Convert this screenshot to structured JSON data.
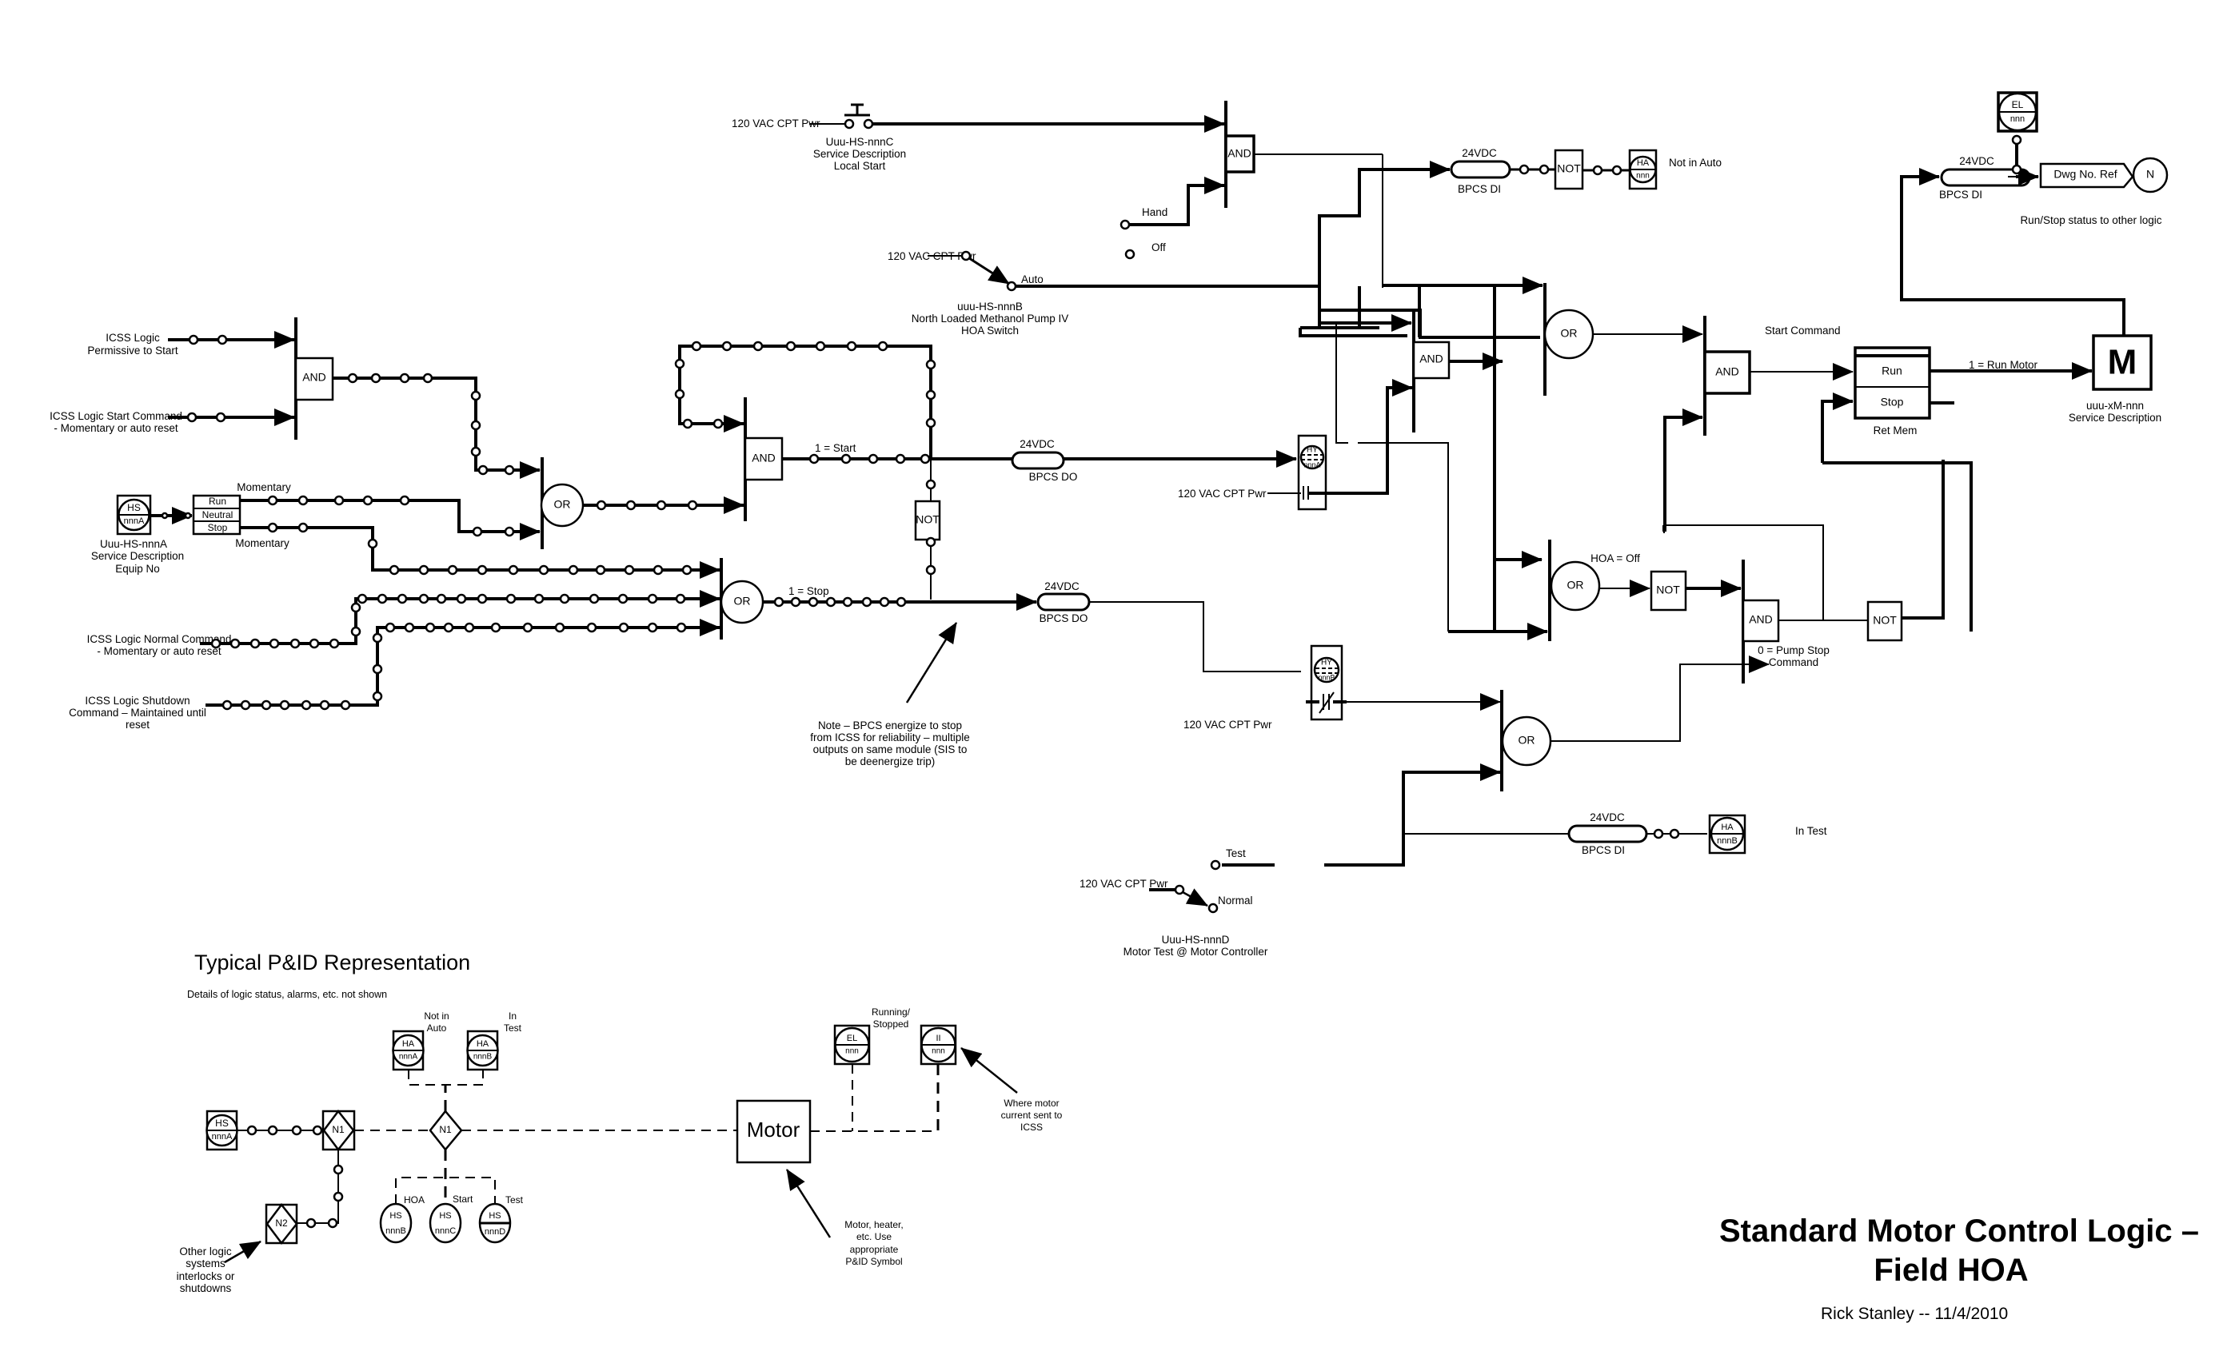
{
  "title": {
    "line1": "Standard Motor Control Logic –",
    "line2": "Field HOA",
    "author_date": "Rick Stanley --  11/4/2010"
  },
  "power_label": "120 VAC CPT Pwr",
  "io": {
    "v24": "24VDC",
    "bpcs_di": "BPCS DI",
    "bpcs_do": "BPCS DO"
  },
  "gates": {
    "and": "AND",
    "or": "OR",
    "not": "NOT"
  },
  "local_start": {
    "tag": "Uuu-HS-nnnC",
    "desc": "Service Description",
    "function": "Local Start"
  },
  "hoa_switch": {
    "tag": "uuu-HS-nnnB",
    "desc": "North Loaded Methanol Pump IV",
    "function": "HOA Switch",
    "positions": [
      "Hand",
      "Off",
      "Auto"
    ]
  },
  "test_switch": {
    "tag": "Uuu-HS-nnnD",
    "desc": "Motor Test @ Motor Controller",
    "positions": [
      "Test",
      "Normal"
    ]
  },
  "icss_inputs": {
    "permissive": [
      "ICSS Logic",
      "Permissive to Start"
    ],
    "start_cmd": [
      "ICSS Logic Start Command",
      "- Momentary or auto reset"
    ],
    "normal_cmd": [
      "ICSS Logic Normal Command",
      "- Momentary or auto reset"
    ],
    "shutdown_cmd": [
      "ICSS Logic Shutdown",
      "Command – Maintained until",
      "reset"
    ]
  },
  "hs_a": {
    "letters": "HS",
    "number": "nnnA",
    "tag": "Uuu-HS-nnnA",
    "desc": "Service Description",
    "equip": "Equip No",
    "selector": [
      "Run",
      "Neutral",
      "Stop"
    ],
    "momentary": "Momentary"
  },
  "signals": {
    "start": "1 = Start",
    "stop": "1 = Stop",
    "hoa_off": "HOA = Off",
    "start_command": "Start Command",
    "pump_stop": [
      "0 = Pump Stop",
      "Command"
    ],
    "run_motor": "1 = Run Motor"
  },
  "hy_a": {
    "letters": "HY",
    "number": "nnnA"
  },
  "hy_b": {
    "letters": "HY",
    "number": "nnnB"
  },
  "ha_not_auto": {
    "letters": "HA",
    "number": "nnn",
    "label": "Not in Auto"
  },
  "ha_in_test": {
    "letters": "HA",
    "number": "nnnB",
    "label": "In Test"
  },
  "el_status": {
    "letters": "EL",
    "number": "nnn"
  },
  "dwg_ref": {
    "label": "Dwg No. Ref",
    "node": "N",
    "caption": "Run/Stop status to other logic"
  },
  "ret_mem": {
    "rows": [
      "Run",
      "Stop"
    ],
    "label": "Ret Mem"
  },
  "motor": {
    "symbol": "M",
    "tag": "uuu-xM-nnn",
    "desc": "Service Description"
  },
  "note_bpcs": [
    "Note – BPCS energize to stop",
    "from ICSS for reliability – multiple",
    "outputs on same module (SIS to",
    "be deenergize trip)"
  ],
  "pid": {
    "title": "Typical P&ID Representation",
    "subtitle": "Details of logic status, alarms, etc. not shown",
    "hs_a": {
      "letters": "HS",
      "number": "nnnA"
    },
    "n1": "N1",
    "n2": "N2",
    "ha_a": {
      "letters": "HA",
      "number": "nnnA",
      "label": [
        "Not in",
        "Auto"
      ]
    },
    "ha_b": {
      "letters": "HA",
      "number": "nnnB",
      "label": [
        "In",
        "Test"
      ]
    },
    "hs_b": {
      "letters": "HS",
      "number": "nnnB",
      "label": "HOA"
    },
    "hs_c": {
      "letters": "HS",
      "number": "nnnC",
      "label": "Start"
    },
    "hs_d": {
      "letters": "HS",
      "number": "nnnD",
      "label": "Test"
    },
    "motor": "Motor",
    "el": {
      "letters": "EL",
      "number": "nnn",
      "label": [
        "Running/",
        "Stopped"
      ]
    },
    "ii": {
      "letters": "II",
      "number": "nnn"
    },
    "note_other": [
      "Other logic",
      "systems",
      "interlocks or",
      "shutdowns"
    ],
    "note_motor": [
      "Motor, heater,",
      "etc. Use",
      "appropriate",
      "P&ID Symbol"
    ],
    "note_current": [
      "Where motor",
      "current sent to",
      "ICSS"
    ]
  }
}
